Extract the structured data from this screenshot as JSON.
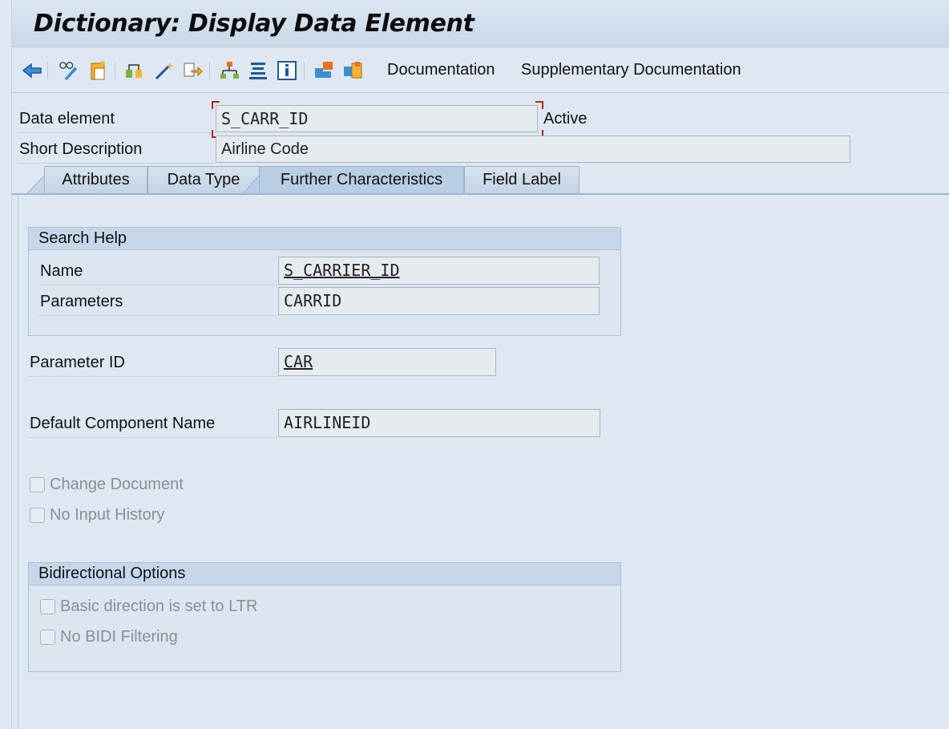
{
  "window": {
    "title": "Dictionary: Display Data Element"
  },
  "toolbar": {
    "icons": [
      "back-icon",
      "display-change-icon",
      "other-object-icon",
      "check-icon",
      "activate-icon",
      "where-used-icon",
      "hierarchy-icon",
      "object-list-icon",
      "info-icon",
      "domain-icon",
      "extended-icon"
    ],
    "documentation_label": "Documentation",
    "supplementary_label": "Supplementary Documentation"
  },
  "header": {
    "data_element_label": "Data element",
    "data_element_value": "S_CARR_ID",
    "status": "Active",
    "short_description_label": "Short Description",
    "short_description_value": "Airline Code"
  },
  "tabs": [
    {
      "label": "Attributes",
      "active": false
    },
    {
      "label": "Data Type",
      "active": false
    },
    {
      "label": "Further Characteristics",
      "active": true
    },
    {
      "label": "Field Label",
      "active": false
    }
  ],
  "search_help": {
    "title": "Search Help",
    "name_label": "Name",
    "name_value": "S_CARRIER_ID",
    "parameters_label": "Parameters",
    "parameters_value": "CARRID"
  },
  "parameter_id": {
    "label": "Parameter ID",
    "value": "CAR"
  },
  "default_component": {
    "label": "Default Component Name",
    "value": "AIRLINEID"
  },
  "checkboxes": {
    "change_document": {
      "label": "Change Document",
      "checked": false
    },
    "no_input_history": {
      "label": "No Input History",
      "checked": false
    }
  },
  "bidi": {
    "title": "Bidirectional Options",
    "basic_direction": {
      "label": "Basic direction is set to LTR",
      "checked": false
    },
    "no_bidi_filtering": {
      "label": "No BIDI Filtering",
      "checked": false
    }
  },
  "colors": {
    "accent": "#0a6ed1",
    "window_bg": "#dde8f3",
    "group_header": "#c6d7ea",
    "focus_corner": "#b8261a"
  }
}
